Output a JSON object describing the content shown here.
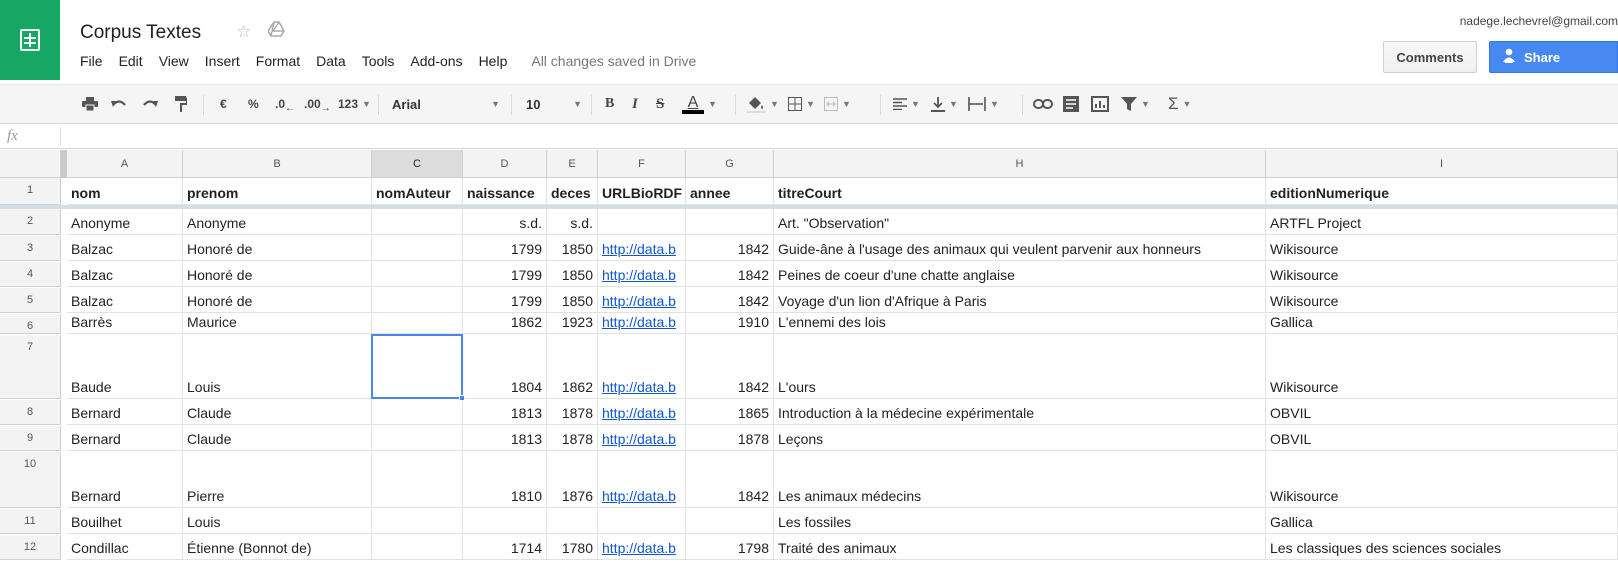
{
  "app": {
    "accent": "#16a765",
    "title": "Corpus Textes"
  },
  "menubar": {
    "items": [
      "File",
      "Edit",
      "View",
      "Insert",
      "Format",
      "Data",
      "Tools",
      "Add-ons",
      "Help"
    ],
    "status": "All changes saved in Drive"
  },
  "header": {
    "user_email": "nadege.lechevrel@gmail.com",
    "comments_label": "Comments",
    "share_label": "Share",
    "share_color": "#4889f1"
  },
  "toolbar": {
    "currency": "€",
    "percent": "%",
    "dec_decrease": ".0",
    "dec_increase": ".00",
    "format_more": "123",
    "font": "Arial",
    "font_size": "10",
    "bold": "B",
    "italic": "I",
    "strike": "S",
    "text_color": "A",
    "sum": "Σ"
  },
  "formula": {
    "label": "fx",
    "value": ""
  },
  "grid": {
    "columns": [
      "A",
      "B",
      "C",
      "D",
      "E",
      "F",
      "G",
      "H",
      "I"
    ],
    "selected_column": "C",
    "selected_cell": "C7",
    "rows": [
      {
        "n": "1",
        "cells": [
          "nom",
          "prenom",
          "nomAuteur",
          "naissance",
          "deces",
          "URLBioRDF",
          "annee",
          "titreCourt",
          "editionNumerique"
        ]
      },
      {
        "n": "2",
        "cells": [
          "Anonyme",
          "Anonyme",
          "",
          "s.d.",
          "s.d.",
          "",
          "",
          "Art. \"Observation\"",
          "ARTFL Project"
        ]
      },
      {
        "n": "3",
        "cells": [
          "Balzac",
          "Honoré de",
          "",
          "1799",
          "1850",
          "http://data.b",
          "1842",
          "Guide-âne à l'usage des animaux qui veulent parvenir aux honneurs",
          "Wikisource"
        ]
      },
      {
        "n": "4",
        "cells": [
          "Balzac",
          "Honoré de",
          "",
          "1799",
          "1850",
          "http://data.b",
          "1842",
          "Peines de coeur d'une chatte anglaise",
          "Wikisource"
        ]
      },
      {
        "n": "5",
        "cells": [
          "Balzac",
          "Honoré de",
          "",
          "1799",
          "1850",
          "http://data.b",
          "1842",
          "Voyage d'un lion d'Afrique à Paris",
          "Wikisource"
        ]
      },
      {
        "n": "6",
        "cells": [
          "Barrès",
          "Maurice",
          "",
          "1862",
          "1923",
          "http://data.b",
          "1910",
          "L'ennemi des lois",
          "Gallica"
        ]
      },
      {
        "n": "7",
        "cells": [
          "Baude",
          "Louis",
          "",
          "1804",
          "1862",
          "http://data.b",
          "1842",
          "L'ours",
          "Wikisource"
        ]
      },
      {
        "n": "8",
        "cells": [
          "Bernard",
          "Claude",
          "",
          "1813",
          "1878",
          "http://data.b",
          "1865",
          "Introduction à la médecine expérimentale",
          "OBVIL"
        ]
      },
      {
        "n": "9",
        "cells": [
          "Bernard",
          "Claude",
          "",
          "1813",
          "1878",
          "http://data.b",
          "1878",
          "Leçons",
          "OBVIL"
        ]
      },
      {
        "n": "10",
        "cells": [
          "Bernard",
          "Pierre",
          "",
          "1810",
          "1876",
          "http://data.b",
          "1842",
          "Les animaux médecins",
          "Wikisource"
        ]
      },
      {
        "n": "11",
        "cells": [
          "Bouilhet",
          "Louis",
          "",
          "",
          "",
          "",
          "",
          "Les fossiles",
          "Gallica"
        ]
      },
      {
        "n": "12",
        "cells": [
          "Condillac",
          "Étienne (Bonnot de)",
          "",
          "1714",
          "1780",
          "http://data.b",
          "1798",
          "Traité des animaux",
          "Les classiques des sciences sociales"
        ]
      }
    ]
  }
}
